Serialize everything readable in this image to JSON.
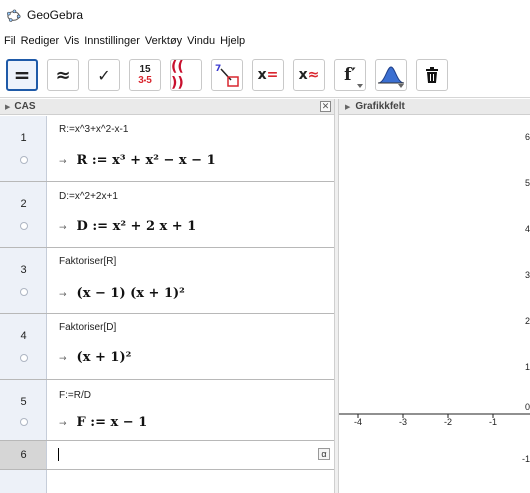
{
  "window": {
    "title": "GeoGebra"
  },
  "menu": [
    "Fil",
    "Rediger",
    "Vis",
    "Innstillinger",
    "Verktøy",
    "Vindu",
    "Hjelp"
  ],
  "toolbar": {
    "tools": [
      {
        "name": "evaluate-tool",
        "glyph": "=",
        "selected": true
      },
      {
        "name": "numeric-tool",
        "glyph": "≈"
      },
      {
        "name": "keep-input-tool",
        "glyph": "✓"
      },
      {
        "name": "factor-number-tool",
        "glyph": "15 / 3·5"
      },
      {
        "name": "expand-tool",
        "glyph": "(( ))"
      },
      {
        "name": "substitute-tool",
        "glyph": "7"
      },
      {
        "name": "solve-tool",
        "glyph": "x="
      },
      {
        "name": "solve-numeric-tool",
        "glyph": "x≈"
      },
      {
        "name": "derivative-tool",
        "glyph": "f'"
      },
      {
        "name": "probability-tool",
        "glyph": "bell"
      },
      {
        "name": "delete-tool",
        "glyph": "trash"
      }
    ],
    "factor_top": "15",
    "factor_bottom_a": "3",
    "factor_bottom_dot": "•",
    "factor_bottom_b": "5",
    "expand_text": "(( ))",
    "substitute_num": "7",
    "solve_x": "x",
    "solve_eq": "=",
    "nsolve_x": "x",
    "nsolve_eq": "≈",
    "deriv_text": "f′"
  },
  "cas": {
    "title": "CAS",
    "rows": [
      {
        "number": "1",
        "input": "R:=x^3+x^2-x-1",
        "output": "R := x³ + x² − x − 1"
      },
      {
        "number": "2",
        "input": "D:=x^2+2x+1",
        "output": "D := x² + 2 x + 1"
      },
      {
        "number": "3",
        "input": "Faktoriser[R]",
        "output": "(x − 1) (x + 1)²"
      },
      {
        "number": "4",
        "input": "Faktoriser[D]",
        "output": "(x + 1)²"
      },
      {
        "number": "5",
        "input": "F:=R/D",
        "output": "F := x − 1"
      },
      {
        "number": "6",
        "input": "",
        "output": ""
      }
    ],
    "arrow": "→",
    "alpha": "α",
    "close": "✕"
  },
  "graphics": {
    "title": "Grafikkfelt",
    "x_ticks": [
      "-4",
      "-3",
      "-2",
      "-1"
    ],
    "y_ticks": [
      "6",
      "5",
      "4",
      "3",
      "2",
      "1",
      "0",
      "-1"
    ]
  },
  "colors": {
    "accent": "#1f5aa8",
    "solve_red": "#d9262f",
    "expand_red": "#c8102e",
    "probability_blue": "#3b6fd1"
  }
}
